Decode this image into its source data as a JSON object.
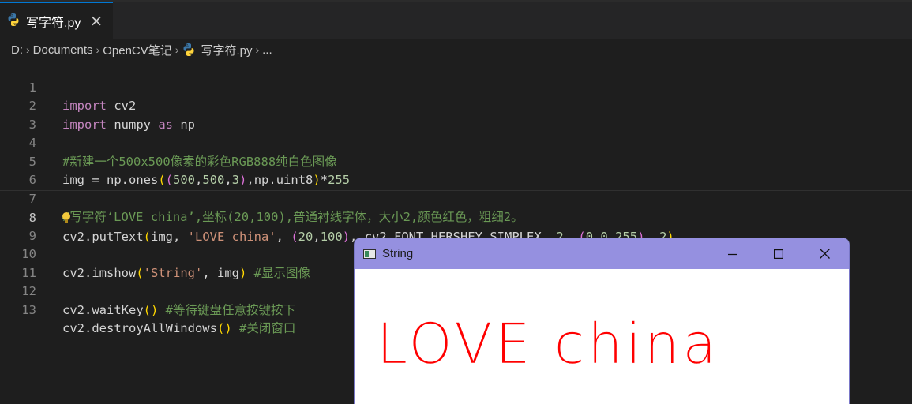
{
  "tab": {
    "label": "写字符.py",
    "close": "×",
    "icon": "python-icon"
  },
  "breadcrumb": [
    "D:",
    "Documents",
    "OpenCV笔记",
    "写字符.py",
    "..."
  ],
  "editor": {
    "active_line": 8,
    "lines": [
      {
        "n": "1"
      },
      {
        "n": "2"
      },
      {
        "n": "3"
      },
      {
        "n": "4"
      },
      {
        "n": "5"
      },
      {
        "n": "6"
      },
      {
        "n": "7"
      },
      {
        "n": "8"
      },
      {
        "n": "9"
      },
      {
        "n": "10"
      },
      {
        "n": "11"
      },
      {
        "n": "12"
      },
      {
        "n": "13"
      }
    ],
    "tokens": {
      "l1": [
        "import",
        " cv2"
      ],
      "l2": [
        "import",
        " numpy ",
        "as",
        " np"
      ],
      "l4": "#新建一个500x500像素的彩色RGB888纯白色图像",
      "l5": [
        "img = np.ones",
        "(",
        "(",
        "500",
        ",",
        "500",
        ",",
        "3",
        ")",
        ",np.uint8",
        ")",
        "*",
        "255"
      ],
      "l7": "#写字符‘LOVE china’,坐标(20,100),普通衬线字体，大小2,颜色红色，粗细2。",
      "l8": [
        "cv2.putText",
        "(",
        "img, ",
        "'LOVE china'",
        ", ",
        "(",
        "20",
        ",",
        "100",
        ")",
        ", cv2.FONT_HERSHEY_SIMPLEX, ",
        "2",
        ", ",
        "(",
        "0",
        ",",
        "0",
        ",",
        "255",
        ")",
        ", ",
        "2",
        ")"
      ],
      "l10": [
        "cv2.imshow",
        "(",
        "'String'",
        ", img",
        ")",
        " #显示图像"
      ],
      "l12": [
        "cv2.waitKey",
        "(",
        ")",
        " #等待键盘任意按键按下"
      ],
      "l13": [
        "cv2.destroyAllWindows",
        "(",
        ")",
        " #关闭窗口"
      ]
    }
  },
  "cv_window": {
    "title": "String",
    "minimize": "minimize-icon",
    "maximize": "maximize-icon",
    "close": "close-icon",
    "rendered_text": "LOVE china",
    "text_color": "#ff0000",
    "titlebar_color": "#9590e0"
  }
}
